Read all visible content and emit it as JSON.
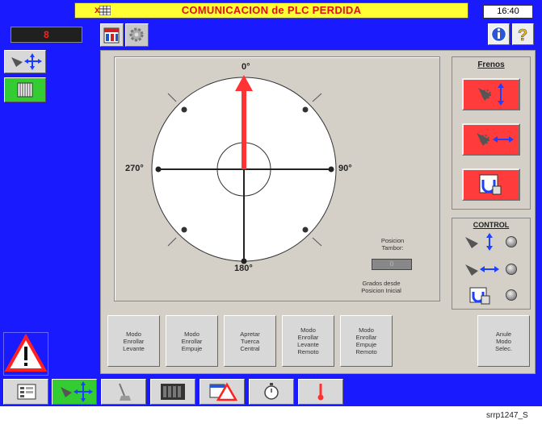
{
  "header": {
    "title": "COMUNICACION de PLC PERDIDA",
    "title_prefix": "x",
    "time": "16:40",
    "alarm_count": "8"
  },
  "dial": {
    "labels": {
      "top": "0°",
      "right": "90°",
      "bottom": "180°",
      "left": "270°"
    },
    "pointer_angle_deg": 0,
    "position_label": "Posicion\nTambor:",
    "position_value": "0",
    "caption": "Grados desde\nPosicion Inicial"
  },
  "frenos": {
    "title": "Frenos"
  },
  "control": {
    "title": "CONTROL"
  },
  "mode_buttons": [
    {
      "label": "Modo\nEnrollar\nLevante"
    },
    {
      "label": "Modo\nEnrollar\nEmpuje"
    },
    {
      "label": "Apretar\nTuerca\nCentral"
    },
    {
      "label": "Modo\nEnrollar\nLevante\nRemoto"
    },
    {
      "label": "Modo\nEnrollar\nEmpuje\nRemoto"
    },
    {
      "label": "Anule\nModo\nSelec."
    }
  ],
  "footer": {
    "code": "srrp1247_S"
  },
  "colors": {
    "background": "#1a1aff",
    "title_bar": "#ffff33",
    "alert_red": "#ff3b3b",
    "active_green": "#33cc33"
  }
}
